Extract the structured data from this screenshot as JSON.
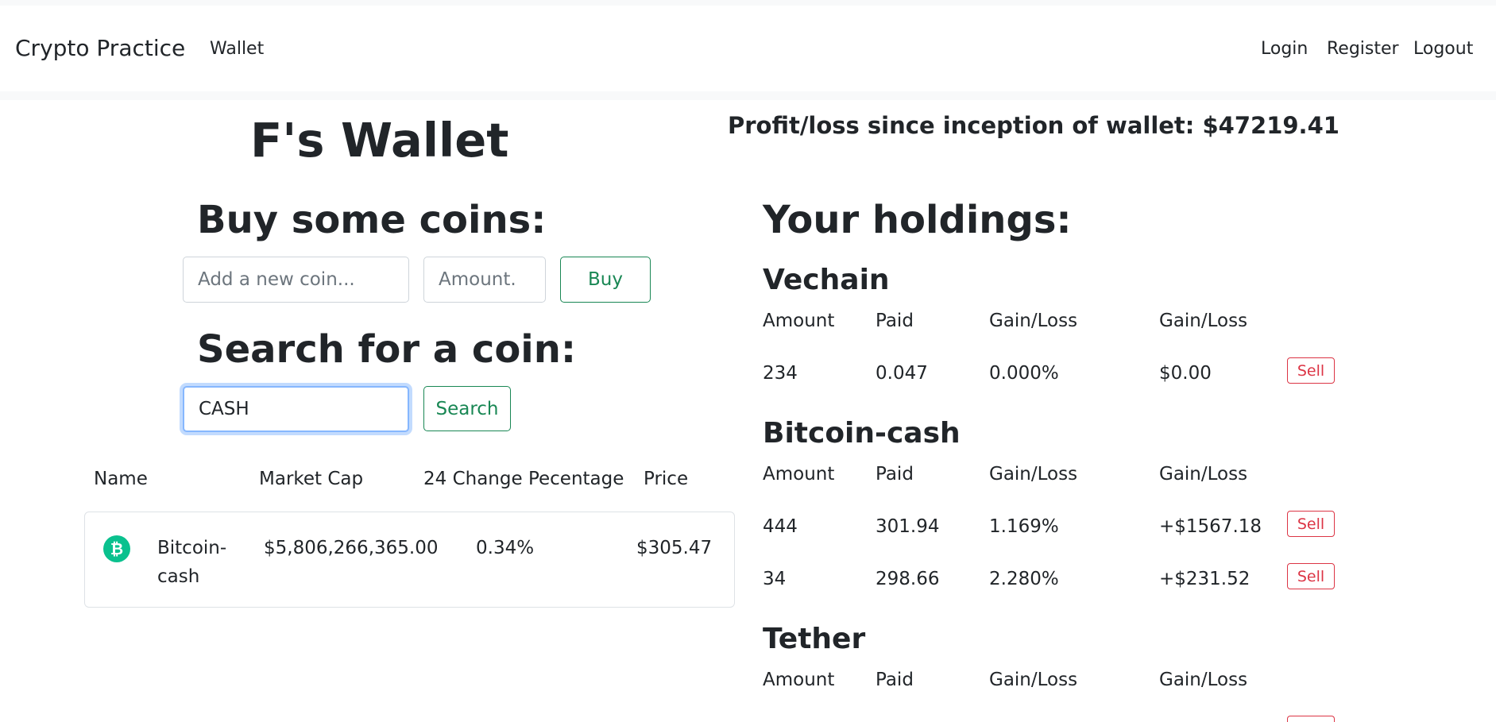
{
  "navbar": {
    "brand": "Crypto Practice",
    "wallet_link": "Wallet",
    "login": "Login",
    "register": "Register",
    "logout": "Logout"
  },
  "wallet": {
    "title": "F's Wallet",
    "profit_text": "Profit/loss since inception of wallet: $47219.41"
  },
  "buy": {
    "heading": "Buy some coins:",
    "coin_placeholder": "Add a new coin...",
    "amount_placeholder": "Amount.",
    "button": "Buy"
  },
  "search": {
    "heading": "Search for a coin:",
    "value": "CASH",
    "button": "Search"
  },
  "results": {
    "headers": [
      "Name",
      "Market Cap",
      "24 Change Pecentage",
      "Price"
    ],
    "rows": [
      {
        "name": "Bitcoin-cash",
        "market_cap": "$5,806,266,365.00",
        "change": "0.34%",
        "price": "$305.47",
        "icon": "bitcoin-cash-icon",
        "icon_color": "#0ac18e"
      }
    ]
  },
  "holdings": {
    "heading": "Your holdings:",
    "columns": [
      "Amount",
      "Paid",
      "Gain/Loss",
      "Gain/Loss"
    ],
    "sell_label": "Sell",
    "coins": [
      {
        "name": "Vechain",
        "rows": [
          {
            "amount": "234",
            "paid": "0.047",
            "pct": "0.000%",
            "usd": "$0.00"
          }
        ]
      },
      {
        "name": "Bitcoin-cash",
        "rows": [
          {
            "amount": "444",
            "paid": "301.94",
            "pct": "1.169%",
            "usd": "+$1567.18"
          },
          {
            "amount": "34",
            "paid": "298.66",
            "pct": "2.280%",
            "usd": "+$231.52"
          }
        ]
      },
      {
        "name": "Tether",
        "rows": []
      }
    ]
  },
  "colors": {
    "success": "#198754",
    "danger": "#dc3545",
    "focus_ring": "#86b7fe",
    "navbar_bg": "#ffffff",
    "page_strip": "#f8f9fa"
  }
}
